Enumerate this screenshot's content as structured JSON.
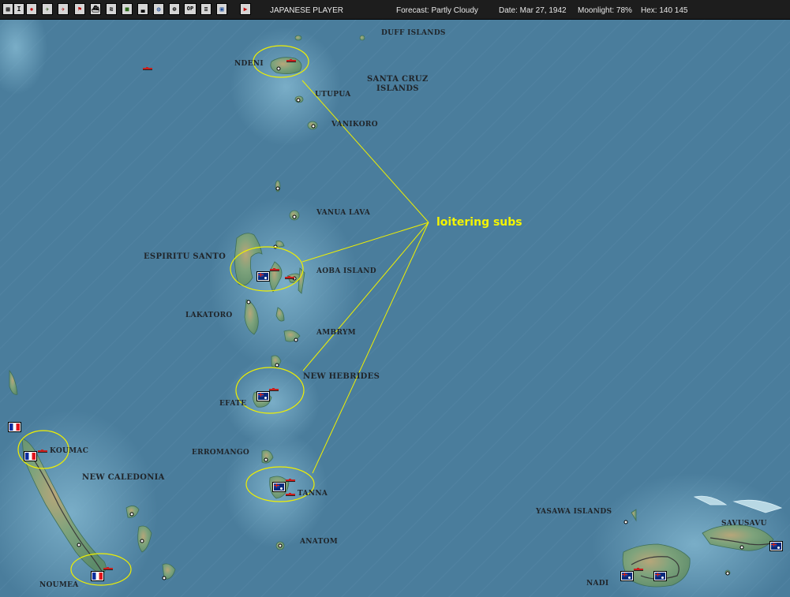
{
  "toolbar": {
    "buttons": [
      {
        "name": "grid-icon",
        "glyph": "▦"
      },
      {
        "name": "info-icon",
        "glyph": "I"
      },
      {
        "name": "rising-sun-icon",
        "glyph": "✹"
      },
      {
        "name": "aircraft-icon",
        "glyph": "✈"
      },
      {
        "name": "airgroup-icon",
        "glyph": "✈"
      },
      {
        "name": "flag-icon",
        "glyph": "⚑"
      },
      {
        "name": "ship-icon",
        "glyph": "⛴"
      },
      {
        "name": "task-force-icon",
        "glyph": "≋"
      },
      {
        "name": "land-unit-icon",
        "glyph": "■"
      },
      {
        "name": "base-icon",
        "glyph": "▃"
      },
      {
        "name": "globe-icon",
        "glyph": "◍"
      },
      {
        "name": "target-icon",
        "glyph": "⊕"
      },
      {
        "name": "ops-icon",
        "glyph": "OP"
      },
      {
        "name": "list-icon",
        "glyph": "≡"
      },
      {
        "name": "screen-icon",
        "glyph": "▣"
      },
      {
        "name": "end-turn-icon",
        "glyph": "▶"
      }
    ],
    "player": "JAPANESE PLAYER",
    "forecast": "Forecast: Partly Cloudy",
    "date": "Date: Mar 27, 1942",
    "moonlight": "Moonlight: 78%",
    "hex": "Hex: 140 145"
  },
  "colors": {
    "ocean": "#4a7d9c",
    "annotation": "#f4f400"
  },
  "map": {
    "labels": {
      "duff_islands": "DUFF ISLANDS",
      "ndeni": "NDENI",
      "santa_cruz_1": "SANTA CRUZ",
      "santa_cruz_2": "ISLANDS",
      "utupua": "UTUPUA",
      "vanikoro": "VANIKORO",
      "vanua_lava": "VANUA LAVA",
      "espiritu_santo": "ESPIRITU SANTO",
      "aoba_island": "AOBA ISLAND",
      "lakatoro": "LAKATORO",
      "ambrym": "AMBRYM",
      "new_hebrides": "NEW HEBRIDES",
      "efate": "EFATE",
      "erromango": "ERROMANGO",
      "koumac": "KOUMAC",
      "new_caledonia": "NEW CALEDONIA",
      "tanna": "TANNA",
      "anatom": "ANATOM",
      "noumea": "NOUMEA",
      "yasawa_islands": "YASAWA ISLANDS",
      "savusavu": "SAVUSAVU",
      "nadi": "NADI"
    },
    "annotation": "loitering subs"
  }
}
